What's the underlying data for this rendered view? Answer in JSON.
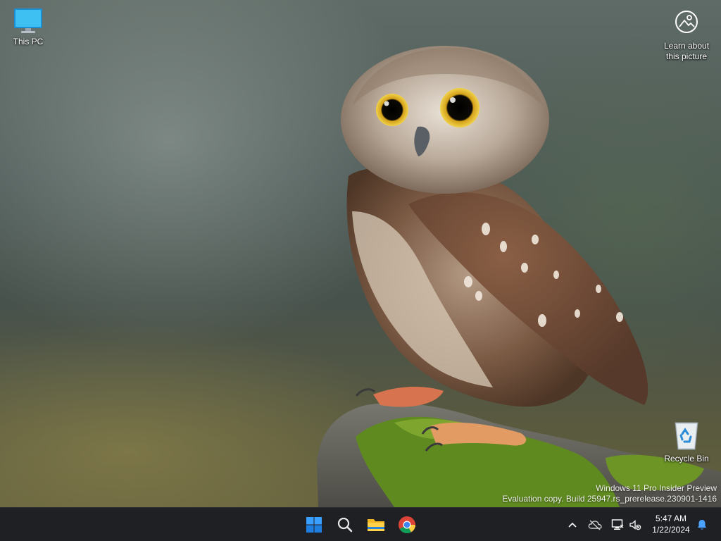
{
  "desktop": {
    "icons": [
      {
        "label": "This PC",
        "icon": "monitor-icon"
      },
      {
        "label": "Recycle Bin",
        "icon": "recycle-bin-icon"
      }
    ],
    "spotlight": {
      "line1": "Learn about",
      "line2": "this picture",
      "icon": "camera-info-icon"
    },
    "watermark": {
      "line1": "Windows 11 Pro Insider Preview",
      "line2": "Evaluation copy. Build 25947.rs_prerelease.230901-1416"
    }
  },
  "taskbar": {
    "apps": [
      {
        "name": "Start",
        "icon": "windows-logo-icon"
      },
      {
        "name": "Search",
        "icon": "search-icon"
      },
      {
        "name": "File Explorer",
        "icon": "folder-icon"
      },
      {
        "name": "Google Chrome",
        "icon": "chrome-icon"
      }
    ],
    "tray": {
      "icons": [
        "chevron-up-icon",
        "onedrive-cloud-icon",
        "network-icon",
        "volume-muted-icon",
        "bell-icon"
      ],
      "time": "5:47 AM",
      "date": "1/22/2024"
    }
  },
  "colors": {
    "taskbar": "#1f2024",
    "accent": "#1e90ff"
  }
}
